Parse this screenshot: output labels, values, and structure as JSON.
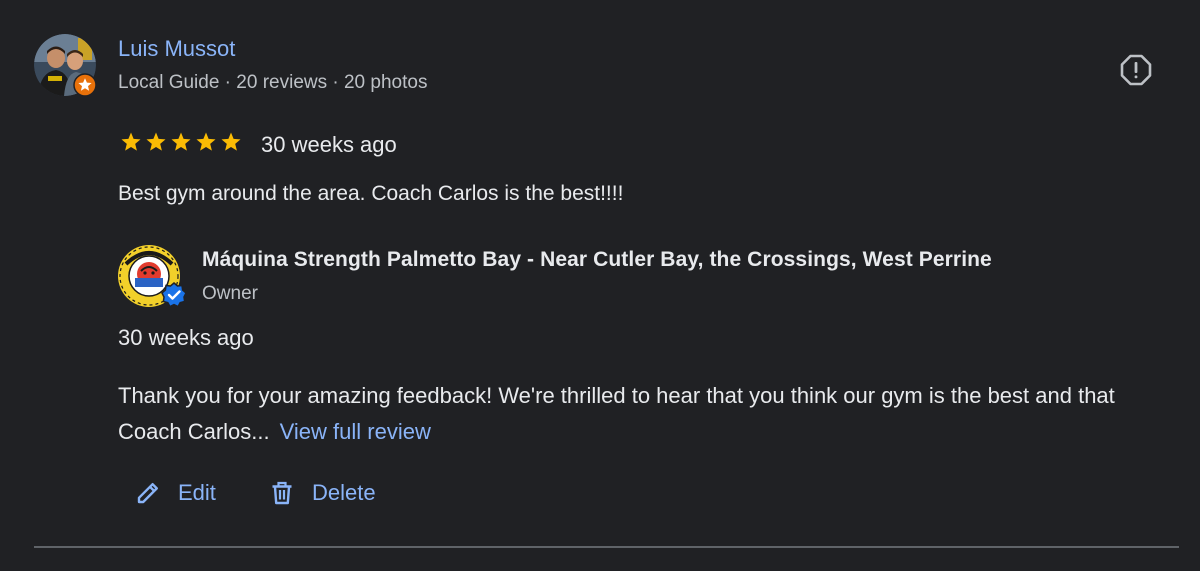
{
  "reviewer": {
    "name": "Luis Mussot",
    "meta": "Local Guide · 20 reviews · 20 photos"
  },
  "review": {
    "rating": 5,
    "time": "30 weeks ago",
    "text": "Best gym around the area. Coach Carlos is the best!!!!"
  },
  "owner_reply": {
    "name": "Máquina Strength Palmetto Bay - Near Cutler Bay, the Crossings, West Perrine",
    "role": "Owner",
    "time": "30 weeks ago",
    "text": "Thank you for your amazing feedback! We're thrilled to hear that you think our gym is the best and that Coach Carlos...",
    "link": "View full review"
  },
  "actions": {
    "edit_label": "Edit",
    "delete_label": "Delete"
  },
  "icons": {
    "report": "report-flag-icon",
    "star": "star-icon",
    "edit": "pencil-icon",
    "delete": "trash-icon",
    "verified": "verified-badge-icon",
    "local_guide": "local-guide-star-icon"
  },
  "colors": {
    "background": "#202124",
    "link": "#8ab4f8",
    "star": "#fbbc04",
    "guide_badge": "#e8710a",
    "verified": "#1a73e8",
    "divider": "#5f6368"
  }
}
